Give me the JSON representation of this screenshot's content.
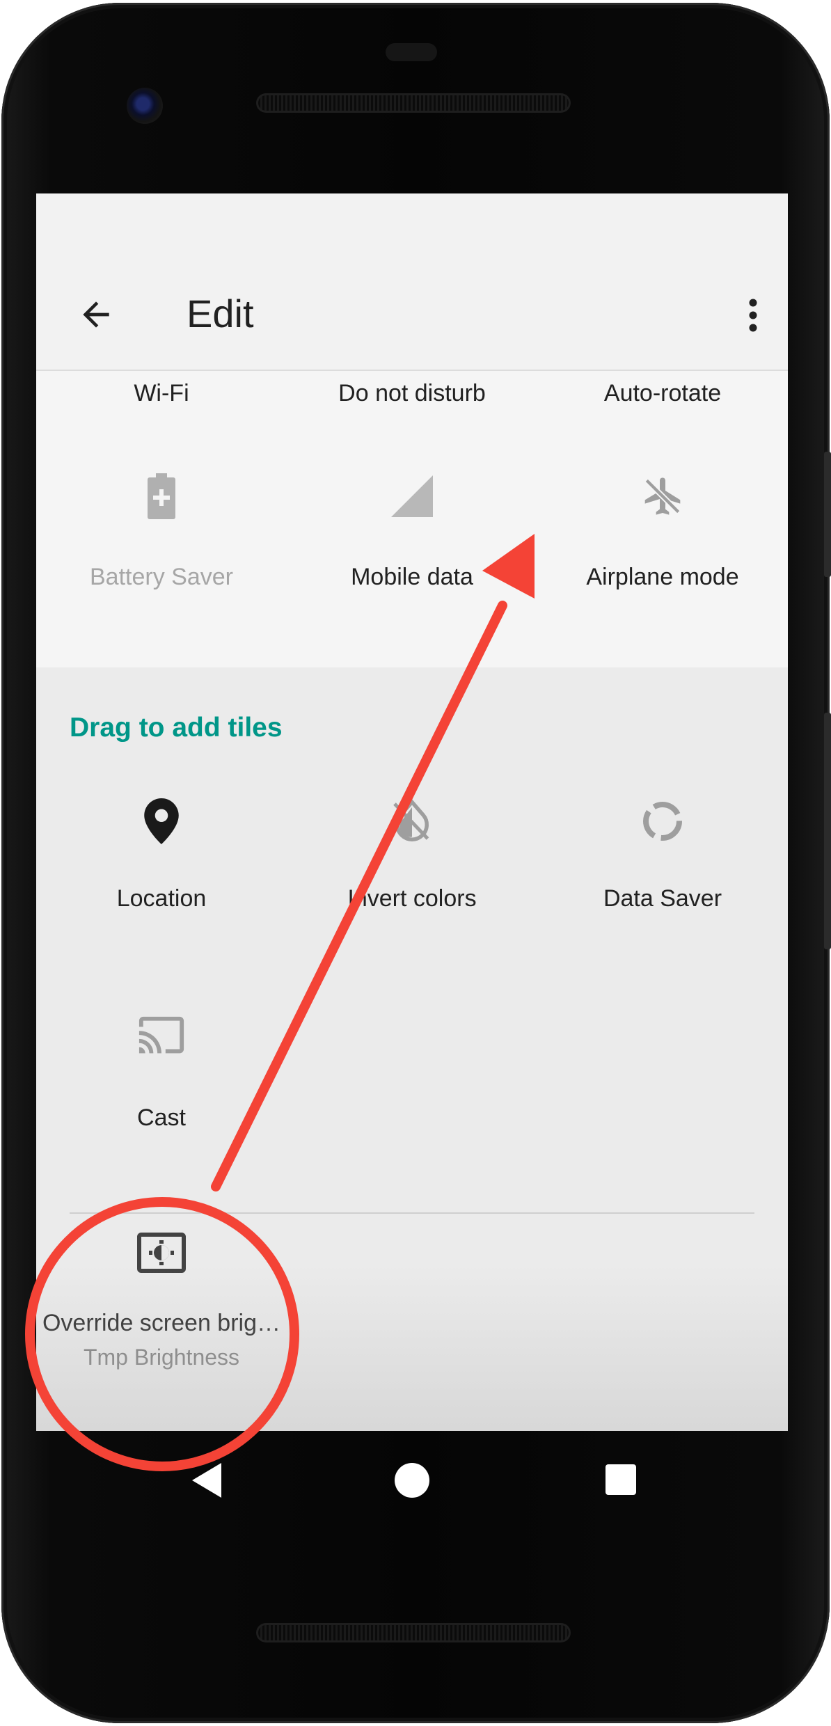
{
  "toolbar": {
    "title": "Edit",
    "back_icon": "arrow-back-icon",
    "menu_icon": "more-vert-icon"
  },
  "active_tiles": {
    "partial_row": [
      "Wi-Fi",
      "Do not disturb",
      "Auto-rotate"
    ],
    "row2": [
      {
        "label": "Battery Saver",
        "icon": "battery-saver-icon",
        "disabled": true
      },
      {
        "label": "Mobile data",
        "icon": "mobile-signal-icon"
      },
      {
        "label": "Airplane mode",
        "icon": "airplane-icon"
      }
    ]
  },
  "add_section": {
    "title": "Drag to add tiles",
    "tiles": [
      {
        "label": "Location",
        "icon": "location-pin-icon"
      },
      {
        "label": "Invert colors",
        "icon": "invert-colors-icon"
      },
      {
        "label": "Data Saver",
        "icon": "data-saver-icon"
      },
      {
        "label": "Cast",
        "icon": "cast-icon"
      }
    ],
    "third_party_tile": {
      "label": "Override screen brig…",
      "sub": "Tmp Brightness",
      "icon": "brightness-icon"
    }
  },
  "colors": {
    "accent": "#009688",
    "annotation": "#f44336"
  }
}
